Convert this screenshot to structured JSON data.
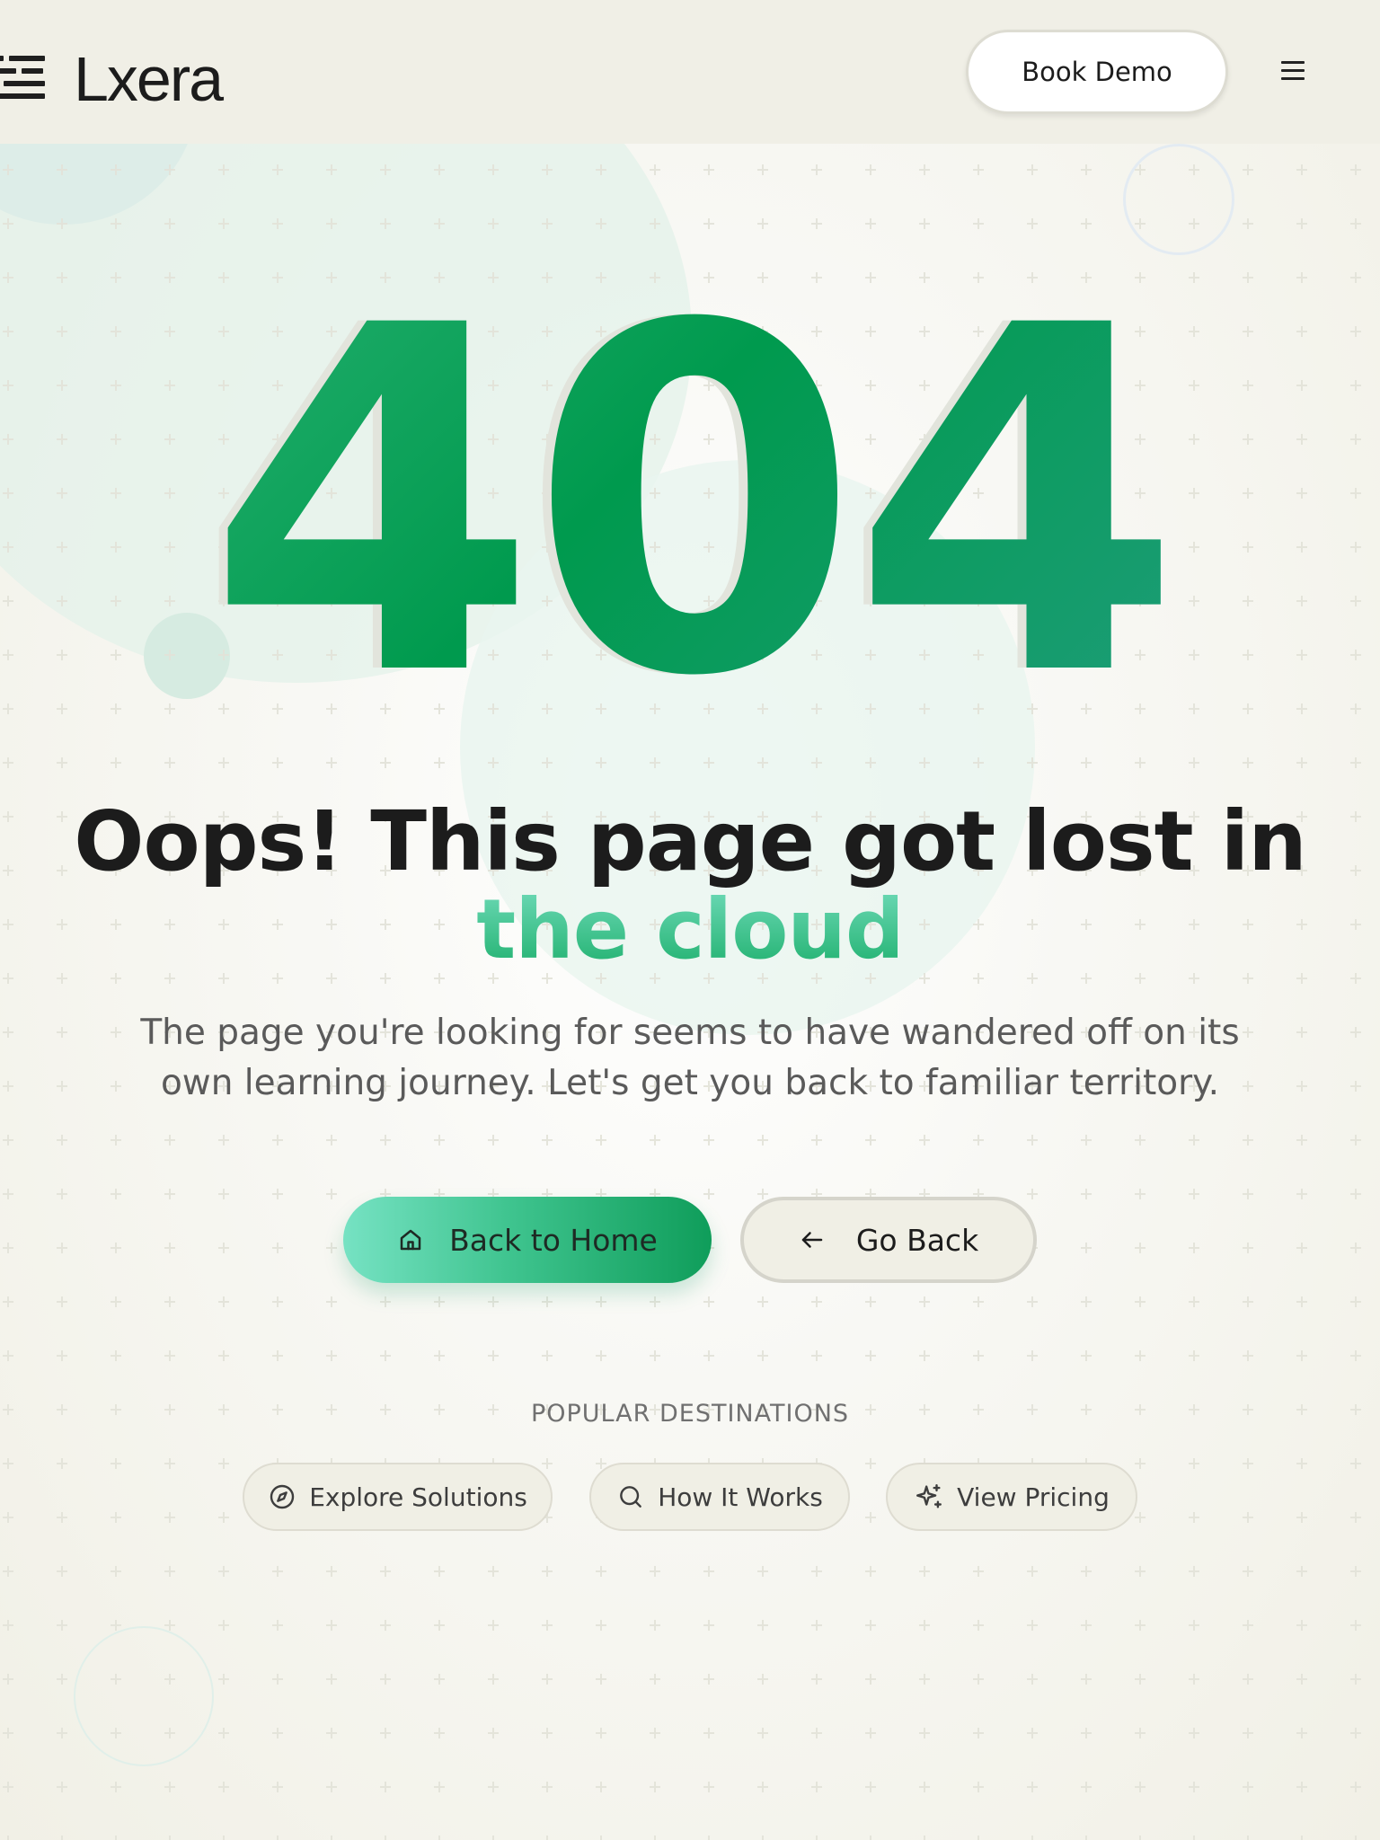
{
  "header": {
    "logo_text": "Lxera",
    "book_demo_label": "Book Demo"
  },
  "hero": {
    "error_code": "404",
    "headline_main": "Oops! This page got lost in ",
    "headline_accent": "the cloud",
    "subtext": "The page you're looking for seems to have wandered off on its own learning journey. Let's get you back to familiar territory."
  },
  "actions": {
    "home_label": "Back to Home",
    "back_label": "Go Back"
  },
  "popular": {
    "heading": "POPULAR DESTINATIONS",
    "links": [
      {
        "label": "Explore Solutions",
        "icon": "compass-icon"
      },
      {
        "label": "How It Works",
        "icon": "search-icon"
      },
      {
        "label": "View Pricing",
        "icon": "sparkles-icon"
      }
    ]
  },
  "colors": {
    "accent_green": "#009a4e",
    "accent_mint": "#72dcbb",
    "header_bg": "#f0efe6"
  }
}
